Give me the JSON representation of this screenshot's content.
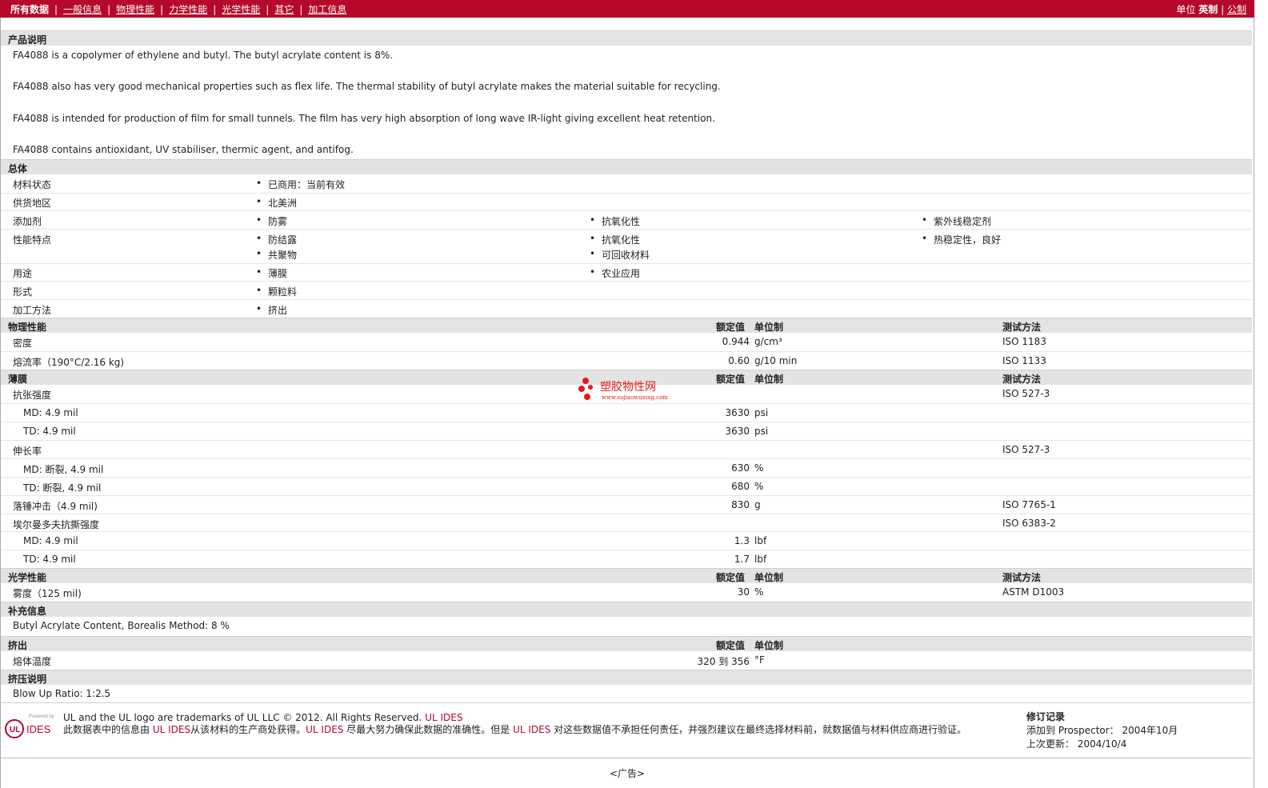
{
  "nav": {
    "items": [
      "所有数据",
      "一般信息",
      "物理性能",
      "力学性能",
      "光学性能",
      "其它",
      "加工信息"
    ],
    "units_label": "单位",
    "units_imperial": "英制",
    "units_metric": "公制"
  },
  "product": {
    "title": "产品说明",
    "lines": [
      "FA4088 is a copolymer of ethylene and butyl. The butyl acrylate content is 8%.",
      "FA4088 also has very good mechanical properties such as flex life. The thermal stability of butyl acrylate makes the material suitable for recycling.",
      "FA4088 is intended for production of film for small tunnels. The film has very high absorption of long wave IR-light giving excellent heat retention.",
      "FA4088 contains antioxidant, UV stabiliser, thermic agent, and antifog."
    ]
  },
  "general": {
    "title": "总体",
    "status_label": "材料状态",
    "status": "已商用：当前有效",
    "region_label": "供货地区",
    "region": "北美洲",
    "additive_label": "添加剂",
    "additives": [
      "防雾",
      "抗氧化性",
      "紫外线稳定剂"
    ],
    "features_label": "性能特点",
    "features": [
      "防结露",
      "抗氧化性",
      "热稳定性，良好",
      "共聚物",
      "可回收材料"
    ],
    "uses_label": "用途",
    "uses": [
      "薄膜",
      "农业应用"
    ],
    "form_label": "形式",
    "form": "颗粒料",
    "process_label": "加工方法",
    "process": "挤出"
  },
  "headers": {
    "nominal": "额定值",
    "unit": "单位制",
    "test": "测试方法"
  },
  "physical": {
    "title": "物理性能",
    "density": {
      "label": "密度",
      "value": "0.944",
      "unit": "g/cm³",
      "test": "ISO 1183"
    },
    "mfr": {
      "label": "熔流率（190°C/2.16 kg)",
      "value": "0.60",
      "unit": "g/10 min",
      "test": "ISO 1133"
    }
  },
  "film": {
    "title": "薄膜",
    "tensile": {
      "label": "抗张强度",
      "test": "ISO 527-3"
    },
    "tensile_md": {
      "label": "MD: 4.9 mil",
      "value": "3630",
      "unit": "psi"
    },
    "tensile_td": {
      "label": "TD: 4.9 mil",
      "value": "3630",
      "unit": "psi"
    },
    "elong": {
      "label": "伸长率",
      "test": "ISO 527-3"
    },
    "elong_md": {
      "label": "MD: 断裂, 4.9 mil",
      "value": "630",
      "unit": "%"
    },
    "elong_td": {
      "label": "TD: 断裂, 4.9 mil",
      "value": "680",
      "unit": "%"
    },
    "dart": {
      "label": "落锤冲击（4.9 mil)",
      "value": "830",
      "unit": "g",
      "test": "ISO 7765-1"
    },
    "tear": {
      "label": "埃尔曼多夫抗撕强度",
      "test": "ISO 6383-2"
    },
    "tear_md": {
      "label": "MD: 4.9 mil",
      "value": "1.3",
      "unit": "lbf"
    },
    "tear_td": {
      "label": "TD: 4.9 mil",
      "value": "1.7",
      "unit": "lbf"
    }
  },
  "optical": {
    "title": "光学性能",
    "haze": {
      "label": "雾度（125 mil)",
      "value": "30",
      "unit": "%",
      "test": "ASTM D1003"
    }
  },
  "supplement": {
    "title": "补充信息",
    "text": "Butyl Acrylate Content, Borealis Method: 8 %"
  },
  "extrusion": {
    "title": "挤出",
    "melt": {
      "label": "熔体温度",
      "value": "320 到  356",
      "unit": "°F"
    }
  },
  "extrusion_note": {
    "title": "挤压说明",
    "text": "Blow Up Ratio: 1:2.5"
  },
  "footer": {
    "logo_small": "Powered by",
    "logo_ul": "UL",
    "logo_ides": "IDES",
    "line1": "UL and the UL logo are trademarks of UL LLC © 2012. All Rights Reserved.",
    "line1_brand": "UL IDES",
    "line2a": "此数据表中的信息由",
    "brand": "UL IDES",
    "line2b": "从该材料的生产商处获得。",
    "line2c": "尽最大努力确保此数据的准确性。但是",
    "line2d": "对这些数据值不承担任何责任，并强烈建议在最终选择材料前，就数据值与材料供应商进行验证。"
  },
  "revision": {
    "title": "修订记录",
    "added": "添加到 Prospector： 2004年10月",
    "updated": "上次更新： 2004/10/4"
  },
  "ad": "<广告>",
  "watermark": {
    "name": "塑胶物性网",
    "url": "www.sujiaowuxing.com"
  }
}
